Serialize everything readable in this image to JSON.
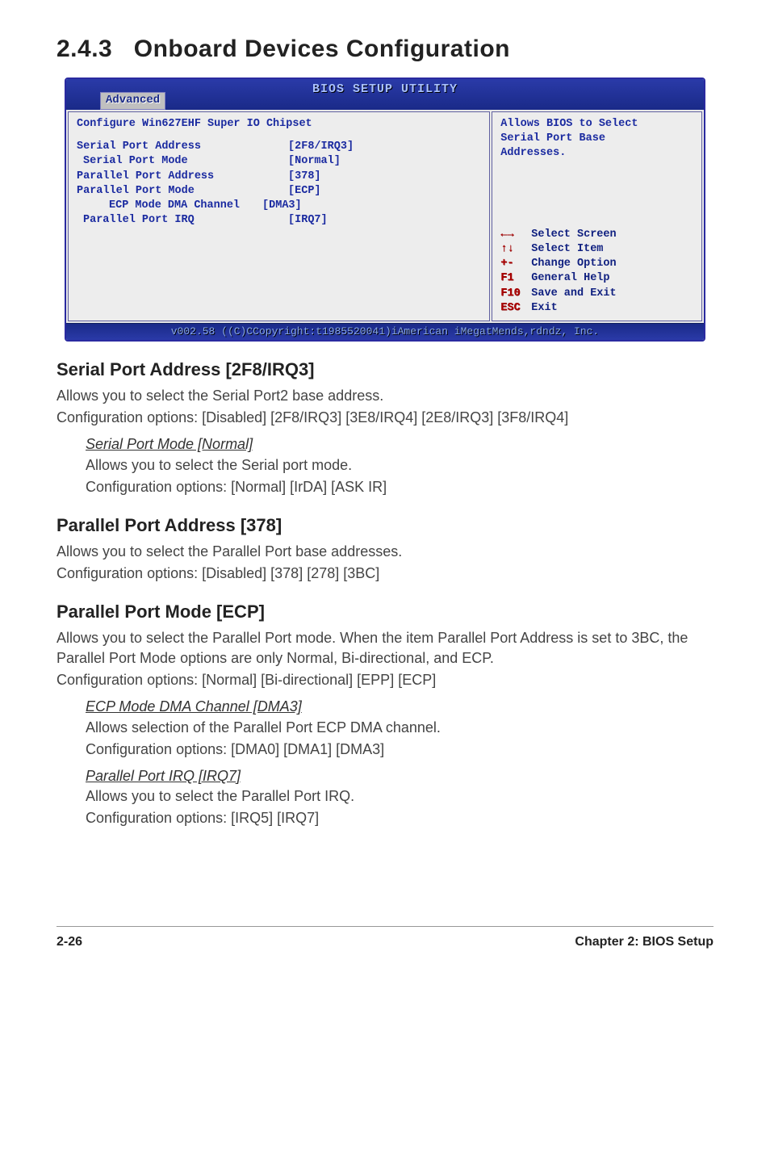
{
  "section": {
    "number": "2.4.3",
    "title": "Onboard Devices Configuration"
  },
  "bios": {
    "window_title": "BIOS SETUP UTILITY",
    "tab": "Advanced",
    "config_header": "Configure Win627EHF Super IO Chipset",
    "rows": [
      {
        "label": "Serial Port Address",
        "indent": 0,
        "value": "[2F8/IRQ3]"
      },
      {
        "label": "Serial Port Mode",
        "indent": 1,
        "value": "[Normal]"
      },
      {
        "label": "Parallel Port Address",
        "indent": 0,
        "value": "[378]"
      },
      {
        "label": "Parallel Port Mode",
        "indent": 0,
        "value": "[ECP]"
      },
      {
        "label": "ECP Mode DMA Channel",
        "indent": 2,
        "value": "[DMA3]"
      },
      {
        "label": "Parallel Port IRQ",
        "indent": 1,
        "value": "[IRQ7]"
      }
    ],
    "help": {
      "l1": "Allows BIOS to Select",
      "l2": "Serial Port Base",
      "l3": "Addresses."
    },
    "nav": [
      {
        "key": "←→",
        "desc": "Select Screen"
      },
      {
        "key": "↑↓",
        "desc": "Select Item"
      },
      {
        "key": "+-",
        "desc": "Change Option"
      },
      {
        "key": "F1",
        "desc": "General Help"
      },
      {
        "key": "F10",
        "desc": "Save and Exit"
      },
      {
        "key": "ESC",
        "desc": "Exit"
      }
    ],
    "footer": "v002.58 ((C)CCopyright:t1985520041)iAmerican iMegatMends,rdndz, Inc."
  },
  "subs": {
    "serial_addr": {
      "title": "Serial Port Address [2F8/IRQ3]",
      "d1": "Allows you to select the Serial Port2 base address.",
      "d2": "Configuration options: [Disabled] [2F8/IRQ3] [3E8/IRQ4] [2E8/IRQ3] [3F8/IRQ4]"
    },
    "serial_mode": {
      "title": "Serial Port Mode [Normal]",
      "d1": "Allows you to select the Serial port mode.",
      "d2": "Configuration options: [Normal] [IrDA] [ASK IR]"
    },
    "par_addr": {
      "title": "Parallel Port Address [378]",
      "d1": "Allows you to select the Parallel Port base addresses.",
      "d2": "Configuration options: [Disabled] [378] [278] [3BC]"
    },
    "par_mode": {
      "title": "Parallel Port Mode [ECP]",
      "d1": "Allows you to select the Parallel Port mode. When the item Parallel Port Address is set to 3BC, the Parallel Port Mode options are only Normal, Bi-directional, and ECP.",
      "d2": "Configuration options: [Normal] [Bi-directional] [EPP] [ECP]"
    },
    "ecp": {
      "title": "ECP Mode DMA Channel [DMA3]",
      "d1": "Allows selection of the Parallel Port ECP DMA channel.",
      "d2": "Configuration options: [DMA0] [DMA1] [DMA3]"
    },
    "par_irq": {
      "title": "Parallel Port IRQ [IRQ7]",
      "d1": "Allows you to select the Parallel Port IRQ.",
      "d2": "Configuration options: [IRQ5] [IRQ7]"
    }
  },
  "footer": {
    "left": "2-26",
    "right": "Chapter 2: BIOS Setup"
  }
}
